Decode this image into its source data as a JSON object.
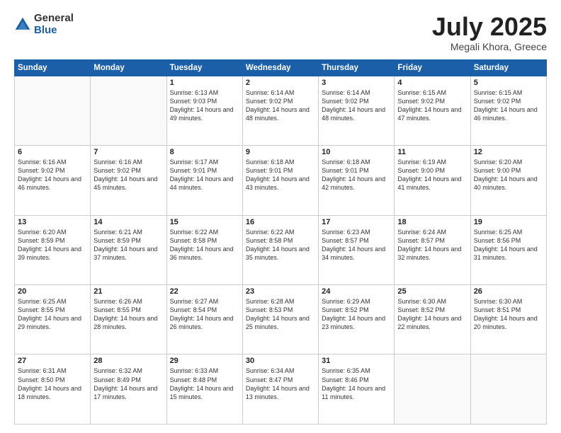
{
  "logo": {
    "general": "General",
    "blue": "Blue"
  },
  "title": {
    "month": "July 2025",
    "location": "Megali Khora, Greece"
  },
  "days_of_week": [
    "Sunday",
    "Monday",
    "Tuesday",
    "Wednesday",
    "Thursday",
    "Friday",
    "Saturday"
  ],
  "weeks": [
    [
      {
        "day": "",
        "info": ""
      },
      {
        "day": "",
        "info": ""
      },
      {
        "day": "1",
        "info": "Sunrise: 6:13 AM\nSunset: 9:03 PM\nDaylight: 14 hours and 49 minutes."
      },
      {
        "day": "2",
        "info": "Sunrise: 6:14 AM\nSunset: 9:02 PM\nDaylight: 14 hours and 48 minutes."
      },
      {
        "day": "3",
        "info": "Sunrise: 6:14 AM\nSunset: 9:02 PM\nDaylight: 14 hours and 48 minutes."
      },
      {
        "day": "4",
        "info": "Sunrise: 6:15 AM\nSunset: 9:02 PM\nDaylight: 14 hours and 47 minutes."
      },
      {
        "day": "5",
        "info": "Sunrise: 6:15 AM\nSunset: 9:02 PM\nDaylight: 14 hours and 46 minutes."
      }
    ],
    [
      {
        "day": "6",
        "info": "Sunrise: 6:16 AM\nSunset: 9:02 PM\nDaylight: 14 hours and 46 minutes."
      },
      {
        "day": "7",
        "info": "Sunrise: 6:16 AM\nSunset: 9:02 PM\nDaylight: 14 hours and 45 minutes."
      },
      {
        "day": "8",
        "info": "Sunrise: 6:17 AM\nSunset: 9:01 PM\nDaylight: 14 hours and 44 minutes."
      },
      {
        "day": "9",
        "info": "Sunrise: 6:18 AM\nSunset: 9:01 PM\nDaylight: 14 hours and 43 minutes."
      },
      {
        "day": "10",
        "info": "Sunrise: 6:18 AM\nSunset: 9:01 PM\nDaylight: 14 hours and 42 minutes."
      },
      {
        "day": "11",
        "info": "Sunrise: 6:19 AM\nSunset: 9:00 PM\nDaylight: 14 hours and 41 minutes."
      },
      {
        "day": "12",
        "info": "Sunrise: 6:20 AM\nSunset: 9:00 PM\nDaylight: 14 hours and 40 minutes."
      }
    ],
    [
      {
        "day": "13",
        "info": "Sunrise: 6:20 AM\nSunset: 8:59 PM\nDaylight: 14 hours and 39 minutes."
      },
      {
        "day": "14",
        "info": "Sunrise: 6:21 AM\nSunset: 8:59 PM\nDaylight: 14 hours and 37 minutes."
      },
      {
        "day": "15",
        "info": "Sunrise: 6:22 AM\nSunset: 8:58 PM\nDaylight: 14 hours and 36 minutes."
      },
      {
        "day": "16",
        "info": "Sunrise: 6:22 AM\nSunset: 8:58 PM\nDaylight: 14 hours and 35 minutes."
      },
      {
        "day": "17",
        "info": "Sunrise: 6:23 AM\nSunset: 8:57 PM\nDaylight: 14 hours and 34 minutes."
      },
      {
        "day": "18",
        "info": "Sunrise: 6:24 AM\nSunset: 8:57 PM\nDaylight: 14 hours and 32 minutes."
      },
      {
        "day": "19",
        "info": "Sunrise: 6:25 AM\nSunset: 8:56 PM\nDaylight: 14 hours and 31 minutes."
      }
    ],
    [
      {
        "day": "20",
        "info": "Sunrise: 6:25 AM\nSunset: 8:55 PM\nDaylight: 14 hours and 29 minutes."
      },
      {
        "day": "21",
        "info": "Sunrise: 6:26 AM\nSunset: 8:55 PM\nDaylight: 14 hours and 28 minutes."
      },
      {
        "day": "22",
        "info": "Sunrise: 6:27 AM\nSunset: 8:54 PM\nDaylight: 14 hours and 26 minutes."
      },
      {
        "day": "23",
        "info": "Sunrise: 6:28 AM\nSunset: 8:53 PM\nDaylight: 14 hours and 25 minutes."
      },
      {
        "day": "24",
        "info": "Sunrise: 6:29 AM\nSunset: 8:52 PM\nDaylight: 14 hours and 23 minutes."
      },
      {
        "day": "25",
        "info": "Sunrise: 6:30 AM\nSunset: 8:52 PM\nDaylight: 14 hours and 22 minutes."
      },
      {
        "day": "26",
        "info": "Sunrise: 6:30 AM\nSunset: 8:51 PM\nDaylight: 14 hours and 20 minutes."
      }
    ],
    [
      {
        "day": "27",
        "info": "Sunrise: 6:31 AM\nSunset: 8:50 PM\nDaylight: 14 hours and 18 minutes."
      },
      {
        "day": "28",
        "info": "Sunrise: 6:32 AM\nSunset: 8:49 PM\nDaylight: 14 hours and 17 minutes."
      },
      {
        "day": "29",
        "info": "Sunrise: 6:33 AM\nSunset: 8:48 PM\nDaylight: 14 hours and 15 minutes."
      },
      {
        "day": "30",
        "info": "Sunrise: 6:34 AM\nSunset: 8:47 PM\nDaylight: 14 hours and 13 minutes."
      },
      {
        "day": "31",
        "info": "Sunrise: 6:35 AM\nSunset: 8:46 PM\nDaylight: 14 hours and 11 minutes."
      },
      {
        "day": "",
        "info": ""
      },
      {
        "day": "",
        "info": ""
      }
    ]
  ]
}
